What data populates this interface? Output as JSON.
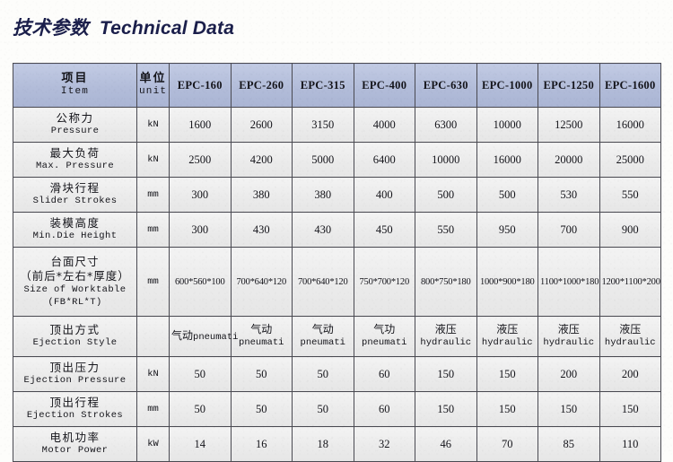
{
  "title": {
    "cn": "技术参数",
    "en": "Technical Data",
    "combined": "技术参数  Technical Data",
    "color": "#1b1f4b"
  },
  "table": {
    "header_bg": "#b2bcd9",
    "body_bg": "#ebebeb",
    "border_color": "#4a4a52",
    "columns": [
      {
        "key": "item",
        "cn": "项目",
        "en": "Item"
      },
      {
        "key": "unit",
        "cn": "单位",
        "en": "unit"
      },
      {
        "key": "epc160",
        "model": "EPC-160"
      },
      {
        "key": "epc260",
        "model": "EPC-260"
      },
      {
        "key": "epc315",
        "model": "EPC-315"
      },
      {
        "key": "epc400",
        "model": "EPC-400"
      },
      {
        "key": "epc630",
        "model": "EPC-630"
      },
      {
        "key": "epc1000",
        "model": "EPC-1000"
      },
      {
        "key": "epc1250",
        "model": "EPC-1250"
      },
      {
        "key": "epc1600",
        "model": "EPC-1600"
      }
    ],
    "rows": [
      {
        "cn": "公称力",
        "en": "Pressure",
        "unit": "kN",
        "values": [
          "1600",
          "2600",
          "3150",
          "4000",
          "6300",
          "10000",
          "12500",
          "16000"
        ]
      },
      {
        "cn": "最大负荷",
        "en": "Max. Pressure",
        "unit": "kN",
        "values": [
          "2500",
          "4200",
          "5000",
          "6400",
          "10000",
          "16000",
          "20000",
          "25000"
        ]
      },
      {
        "cn": "滑块行程",
        "en": "Slider Strokes",
        "unit": "mm",
        "values": [
          "300",
          "380",
          "380",
          "400",
          "500",
          "500",
          "530",
          "550"
        ]
      },
      {
        "cn": "装模高度",
        "en": "Min.Die Height",
        "unit": "mm",
        "values": [
          "300",
          "430",
          "430",
          "450",
          "550",
          "950",
          "700",
          "900"
        ]
      },
      {
        "cn": "台面尺寸",
        "cn2": "（前后*左右*厚度）",
        "en": "Size of Worktable",
        "en2": "(FB*RL*T)",
        "unit": "mm",
        "values": [
          "600*560*100",
          "700*640*120",
          "700*640*120",
          "750*700*120",
          "800*750*180",
          "1000*900*180",
          "1100*1000*180",
          "1200*1100*200"
        ]
      },
      {
        "cn": "顶出方式",
        "en": "Ejection Style",
        "unit": "",
        "values_cn": [
          "气动",
          "气动",
          "气动",
          "气功",
          "液压",
          "液压",
          "液压",
          "液压"
        ],
        "values_en": [
          "pneumati",
          "pneumati",
          "pneumati",
          "pneumati",
          "hydraulic",
          "hydraulic",
          "hydraulic",
          "hydraulic"
        ]
      },
      {
        "cn": "顶出压力",
        "en": "Ejection Pressure",
        "unit": "kN",
        "values": [
          "50",
          "50",
          "50",
          "60",
          "150",
          "150",
          "200",
          "200"
        ]
      },
      {
        "cn": "顶出行程",
        "en": "Ejection Strokes",
        "unit": "mm",
        "values": [
          "50",
          "50",
          "50",
          "60",
          "150",
          "150",
          "150",
          "150"
        ]
      },
      {
        "cn": "电机功率",
        "en": "Motor Power",
        "unit": "kW",
        "values": [
          "14",
          "16",
          "18",
          "32",
          "46",
          "70",
          "85",
          "110"
        ]
      }
    ]
  }
}
